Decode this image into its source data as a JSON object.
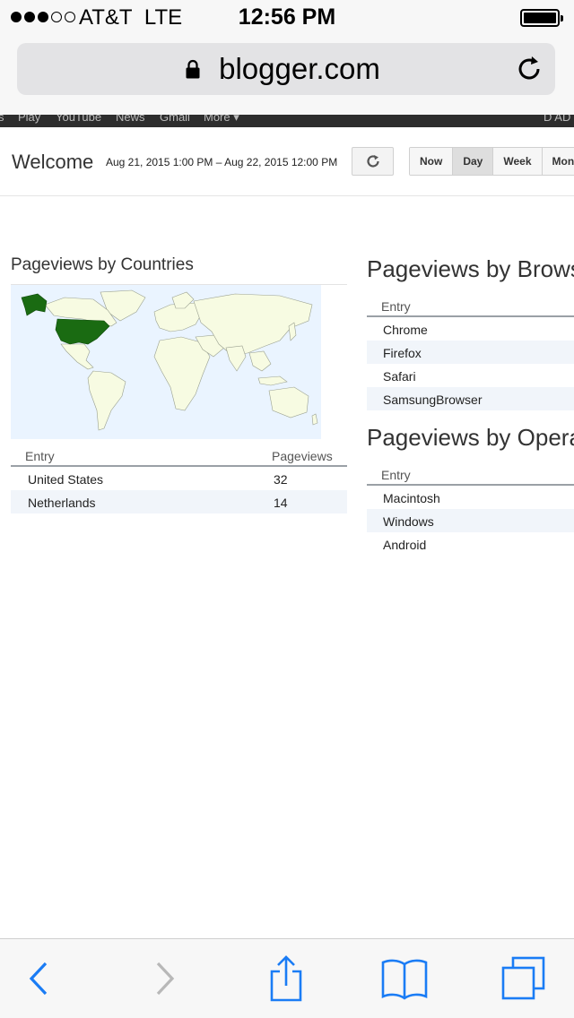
{
  "status_bar": {
    "carrier": "AT&T",
    "network": "LTE",
    "time": "12:56 PM"
  },
  "browser": {
    "url": "blogger.com"
  },
  "google_bar": {
    "items": [
      "s",
      "Play",
      "YouTube",
      "News",
      "Gmail",
      "More ▾",
      "D AD"
    ]
  },
  "header": {
    "title": "Welcome",
    "date_range": "Aug 21, 2015 1:00 PM – Aug 22, 2015 12:00 PM",
    "ranges": [
      "Now",
      "Day",
      "Week",
      "Mont"
    ],
    "active_range": "Day"
  },
  "countries": {
    "title": "Pageviews by Countries",
    "col_entry": "Entry",
    "col_pageviews": "Pageviews",
    "rows": [
      {
        "entry": "United States",
        "pageviews": "32"
      },
      {
        "entry": "Netherlands",
        "pageviews": "14"
      }
    ],
    "colors": {
      "highlight": "#1a6b12",
      "land": "#f7fbe2",
      "water": "#eaf4ff"
    }
  },
  "browsers": {
    "title": "Pageviews by Brows",
    "col_entry": "Entry",
    "rows": [
      "Chrome",
      "Firefox",
      "Safari",
      "SamsungBrowser"
    ]
  },
  "os": {
    "title": "Pageviews by Opera",
    "col_entry": "Entry",
    "rows": [
      "Macintosh",
      "Windows",
      "Android"
    ]
  },
  "toolbar": {
    "accent": "#1a7cf5"
  }
}
